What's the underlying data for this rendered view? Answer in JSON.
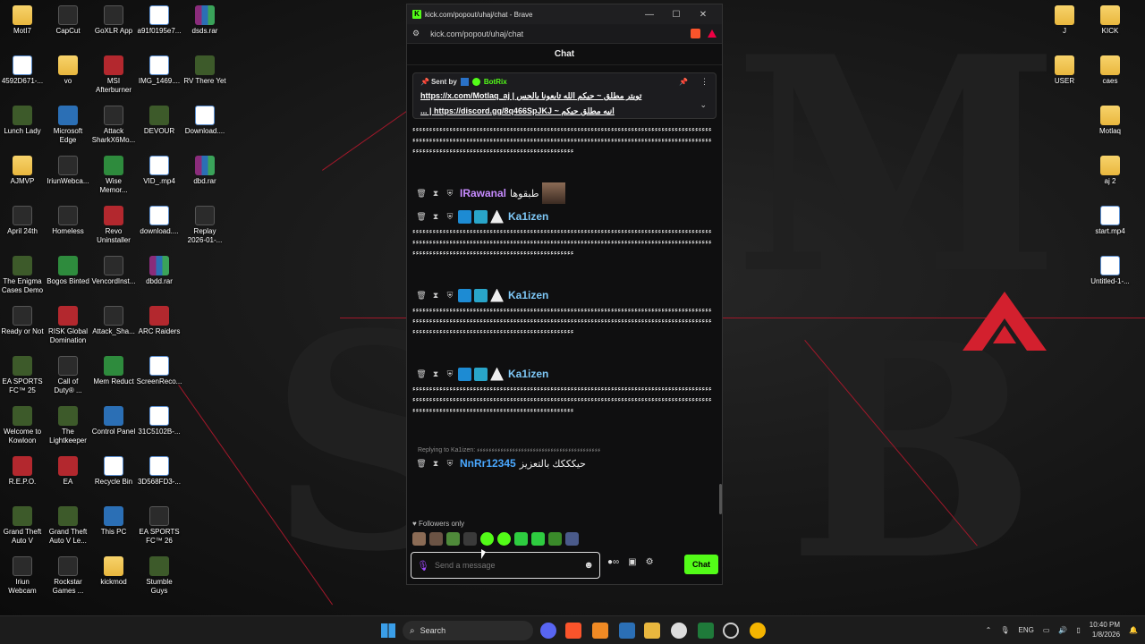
{
  "desktop_left": [
    {
      "label": "MotI7",
      "icon": "folder",
      "type": "folder"
    },
    {
      "label": "CapCut",
      "icon": "capcut-icon",
      "type": "app"
    },
    {
      "label": "GoXLR App",
      "icon": "goxlr-icon",
      "type": "app"
    },
    {
      "label": "a91f0195e7...",
      "icon": "file-icon",
      "type": "file"
    },
    {
      "label": "dsds.rar",
      "icon": "rar-icon",
      "type": "rar"
    },
    {
      "label": "4592D671-...",
      "icon": "file-icon",
      "type": "file"
    },
    {
      "label": "vo",
      "icon": "folder",
      "type": "folder"
    },
    {
      "label": "MSI\nAfterburner",
      "icon": "msi-icon",
      "type": "red"
    },
    {
      "label": "IMG_1469....",
      "icon": "file-icon",
      "type": "file"
    },
    {
      "label": "RV There Yet",
      "icon": "game-icon",
      "type": "game"
    },
    {
      "label": "Lunch Lady",
      "icon": "game-icon",
      "type": "game"
    },
    {
      "label": "Microsoft\nEdge",
      "icon": "edge-icon",
      "type": "blue"
    },
    {
      "label": "Attack\nSharkX6Mo...",
      "icon": "shark-icon",
      "type": "app"
    },
    {
      "label": "DEVOUR",
      "icon": "game-icon",
      "type": "game"
    },
    {
      "label": "Download....",
      "icon": "file-icon",
      "type": "file"
    },
    {
      "label": "AJMVP",
      "icon": "folder",
      "type": "folder"
    },
    {
      "label": "IriunWebca...",
      "icon": "webcam-icon",
      "type": "app"
    },
    {
      "label": "Wise\nMemor...",
      "icon": "wise-icon",
      "type": "green"
    },
    {
      "label": "VID_.mp4",
      "icon": "file-icon",
      "type": "file"
    },
    {
      "label": "dbd.rar",
      "icon": "rar-icon",
      "type": "rar"
    },
    {
      "label": "April 24th",
      "icon": "game-icon",
      "type": "app"
    },
    {
      "label": "Homeless",
      "icon": "game-icon",
      "type": "app"
    },
    {
      "label": "Revo\nUninstaller",
      "icon": "revo-icon",
      "type": "red"
    },
    {
      "label": "download....",
      "icon": "file-icon",
      "type": "file"
    },
    {
      "label": "Replay\n2026-01-...",
      "icon": "replay-icon",
      "type": "app"
    },
    {
      "label": "The Enigma\nCases Demo",
      "icon": "game-icon",
      "type": "game"
    },
    {
      "label": "Bogos Binted",
      "icon": "game-icon",
      "type": "green"
    },
    {
      "label": "VencordInst...",
      "icon": "vencord-icon",
      "type": "app"
    },
    {
      "label": "dbdd.rar",
      "icon": "rar-icon",
      "type": "rar"
    },
    {
      "label": "",
      "icon": "",
      "type": "none"
    },
    {
      "label": "Ready or Not",
      "icon": "game-icon",
      "type": "app"
    },
    {
      "label": "RISK Global\nDomination",
      "icon": "risk-icon",
      "type": "red"
    },
    {
      "label": "Attack_Sha...",
      "icon": "shark-icon",
      "type": "app"
    },
    {
      "label": "ARC Raiders",
      "icon": "arc-icon",
      "type": "red"
    },
    {
      "label": "",
      "icon": "",
      "type": "none"
    },
    {
      "label": "EA SPORTS\nFC™ 25",
      "icon": "ea-icon",
      "type": "game"
    },
    {
      "label": "Call of\nDuty® ...",
      "icon": "cod-icon",
      "type": "app"
    },
    {
      "label": "Mem Reduct",
      "icon": "memreduct-icon",
      "type": "green"
    },
    {
      "label": "ScreenReco...",
      "icon": "file-icon",
      "type": "file"
    },
    {
      "label": "",
      "icon": "",
      "type": "none"
    },
    {
      "label": "Welcome to\nKowloon",
      "icon": "game-icon",
      "type": "game"
    },
    {
      "label": "The\nLightkeeper",
      "icon": "game-icon",
      "type": "game"
    },
    {
      "label": "Control Panel",
      "icon": "control-panel-icon",
      "type": "blue"
    },
    {
      "label": "31C5102B-...",
      "icon": "file-icon",
      "type": "file"
    },
    {
      "label": "",
      "icon": "",
      "type": "none"
    },
    {
      "label": "R.E.P.O.",
      "icon": "game-icon",
      "type": "red"
    },
    {
      "label": "EA",
      "icon": "ea-icon",
      "type": "red"
    },
    {
      "label": "Recycle Bin",
      "icon": "recycle-bin-icon",
      "type": "file"
    },
    {
      "label": "3D568FD3-...",
      "icon": "file-icon",
      "type": "file"
    },
    {
      "label": "",
      "icon": "",
      "type": "none"
    },
    {
      "label": "Grand Theft\nAuto V",
      "icon": "gta-icon",
      "type": "game"
    },
    {
      "label": "Grand Theft\nAuto V Le...",
      "icon": "gta-icon",
      "type": "game"
    },
    {
      "label": "This PC",
      "icon": "this-pc-icon",
      "type": "blue"
    },
    {
      "label": "EA SPORTS\nFC™ 26",
      "icon": "ea-icon",
      "type": "app"
    },
    {
      "label": "",
      "icon": "",
      "type": "none"
    },
    {
      "label": "Iriun\nWebcam",
      "icon": "webcam-icon",
      "type": "app"
    },
    {
      "label": "Rockstar\nGames ...",
      "icon": "rockstar-icon",
      "type": "app"
    },
    {
      "label": "kickmod",
      "icon": "folder",
      "type": "folder"
    },
    {
      "label": "Stumble\nGuys",
      "icon": "game-icon",
      "type": "game"
    }
  ],
  "desktop_right": [
    {
      "label": "J",
      "type": "folder"
    },
    {
      "label": "KICK",
      "type": "folder"
    },
    {
      "label": "USER",
      "type": "folder"
    },
    {
      "label": "caes",
      "type": "folder"
    },
    {
      "label": "",
      "type": "none"
    },
    {
      "label": "Motlaq",
      "type": "folder"
    },
    {
      "label": "",
      "type": "none"
    },
    {
      "label": "aj 2",
      "type": "folder"
    },
    {
      "label": "",
      "type": "none"
    },
    {
      "label": "start.mp4",
      "type": "file"
    },
    {
      "label": "",
      "type": "none"
    },
    {
      "label": "Untitled-1-...",
      "type": "file"
    }
  ],
  "browser": {
    "title": "kick.com/popout/uhaj/chat - Brave",
    "url": "kick.com/popout/uhaj/chat",
    "minimize": "—",
    "maximize": "☐",
    "close": "✕"
  },
  "chat": {
    "header": "Chat",
    "pinned": {
      "sent_by": "Sent by",
      "bot_name": "BotRix",
      "line1": "تويتر مطلق ~ حيكم الله تابعونا بالحس | https://x.com/Motlaq_aj",
      "line2": "انيه مطلق حيكم ~ https://discord.gg/8q466SpJKJ | ..."
    },
    "spam_block": "ءءءءءءءءءءءءءءءءءءءءءءءءءءءءءءءءءءءءءءءءءءءءءءءءءءءءءءءءءءءءءءءءءءءءءءءءءءءءءءءءءءءءءءءءءءءءءءءءءءءءءءءءءءءءءءءءءءءءءءءءءءءءءءءءءءءءءءءءءءءءءءءءءءءءءءءءءءءءءءءءءءءءءءءءءءءءءءءءءءءءءءءءءءءءءءءءءءءءءءءءءءءءءءءءءءءءءءءءءءءءءءءءءء",
    "messages": [
      {
        "user": "IRawanal",
        "color": "#c78bff",
        "text": "طبقوها"
      },
      {
        "user": "Ka1izen",
        "color": "#7ec8f7",
        "text": ""
      },
      {
        "user": "Ka1izen",
        "color": "#7ec8f7",
        "text": ""
      },
      {
        "user": "Ka1izen",
        "color": "#7ec8f7",
        "text": ""
      }
    ],
    "reply_context": "Replying to Ka1izen: ءءءءءءءءءءءءءءءءءءءءءءءءءءءءءءءءءءءءءءءءءء",
    "last": {
      "user": "NnRr12345",
      "color": "#4aa8ff",
      "text": "حيكككك بالتعزيز"
    },
    "followers_only": "Followers only",
    "input_placeholder": "Send a message",
    "send_label": "Chat"
  },
  "taskbar": {
    "search_placeholder": "Search",
    "lang": "ENG",
    "time": "10:40 PM",
    "date": "1/8/2026"
  },
  "colors": {
    "kick_green": "#53fc18",
    "wallpaper_accent": "#a1182a"
  }
}
